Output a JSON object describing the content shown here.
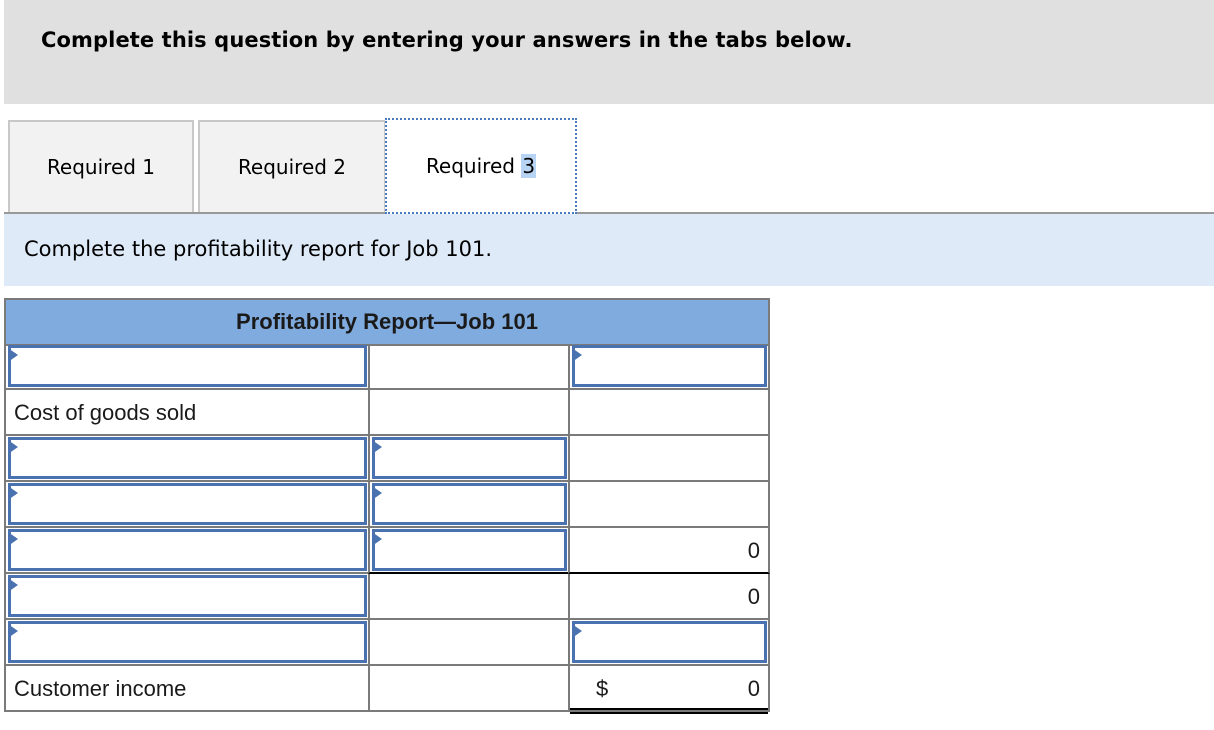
{
  "instructions": "Complete this question by entering your answers in the tabs below.",
  "tabs": [
    {
      "label": "Required 1",
      "active": false
    },
    {
      "label": "Required 2",
      "active": false
    },
    {
      "label_prefix": "Required ",
      "label_highlight": "3",
      "active": true
    }
  ],
  "prompt": "Complete the profitability report for Job 101.",
  "report": {
    "title": "Profitability Report—Job 101",
    "rows": [
      {
        "label": "",
        "label_input": true,
        "col2": "",
        "col2_input": false,
        "col3": "",
        "col3_input": true
      },
      {
        "label": "Cost of goods sold",
        "label_input": false,
        "col2": "",
        "col2_input": false,
        "col3": "",
        "col3_input": false
      },
      {
        "label": "",
        "label_input": true,
        "col2": "",
        "col2_input": true,
        "col3": "",
        "col3_input": false
      },
      {
        "label": "",
        "label_input": true,
        "col2": "",
        "col2_input": true,
        "col3": "",
        "col3_input": false
      },
      {
        "label": "",
        "label_input": true,
        "col2": "",
        "col2_input": true,
        "col3": "0",
        "col3_input": false
      },
      {
        "label": "",
        "label_input": true,
        "col2": "",
        "col2_input": false,
        "col3": "0",
        "col3_input": false
      },
      {
        "label": "",
        "label_input": true,
        "col2": "",
        "col2_input": false,
        "col3": "",
        "col3_input": true
      },
      {
        "label": "Customer income",
        "label_input": false,
        "col2": "",
        "col2_input": false,
        "col3_currency": "$",
        "col3": "0",
        "col3_input": false
      }
    ]
  },
  "colors": {
    "header_bg": "#e0e0e0",
    "prompt_bg": "#deeaf7",
    "report_header_bg": "#80abde",
    "input_border": "#4a72b0",
    "tab_focus_outline": "#4a7bbf",
    "selection_highlight": "#b8d4f5"
  }
}
